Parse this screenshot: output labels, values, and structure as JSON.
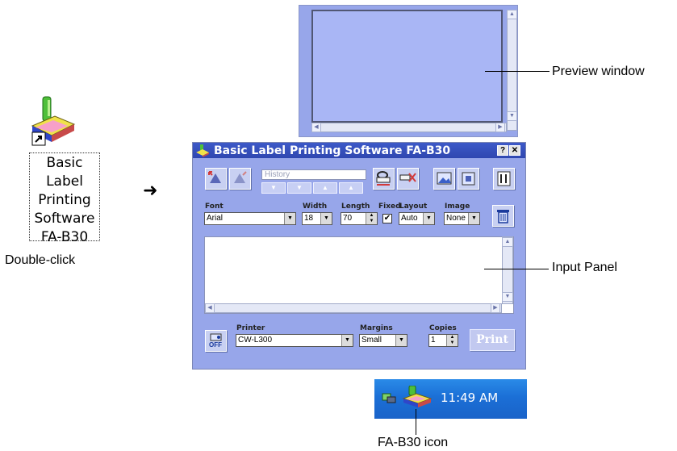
{
  "shortcut": {
    "label_lines": [
      "Basic Label",
      "Printing",
      "Software",
      "FA-B30"
    ],
    "icon": "label-printer-icon"
  },
  "annotations": {
    "double_click": "Double-click",
    "arrow": "➜",
    "preview_window": "Preview window",
    "input_panel": "Input Panel",
    "tray_icon": "FA-B30 icon"
  },
  "window": {
    "title": "Basic Label Printing Software FA-B30",
    "help_button": "?",
    "close_button": "✕",
    "history_placeholder": "History",
    "font": {
      "label": "Font",
      "value": "Arial"
    },
    "width": {
      "label": "Width",
      "value": "18"
    },
    "length": {
      "label": "Length",
      "value": "70"
    },
    "fixed": {
      "label": "Fixed",
      "checked": true
    },
    "layout": {
      "label": "Layout",
      "value": "Auto"
    },
    "image": {
      "label": "Image",
      "value": "None"
    },
    "printer": {
      "label": "Printer",
      "value": "CW-L300"
    },
    "margins": {
      "label": "Margins",
      "value": "Small"
    },
    "copies": {
      "label": "Copies",
      "value": "1"
    },
    "print_button": "Print",
    "off_label": "OFF"
  },
  "taskbar": {
    "time": "11:49 AM"
  },
  "colors": {
    "window_bg": "#97a6ea",
    "title_bar": "#2f47b0",
    "taskbar": "#1b6fd6"
  }
}
